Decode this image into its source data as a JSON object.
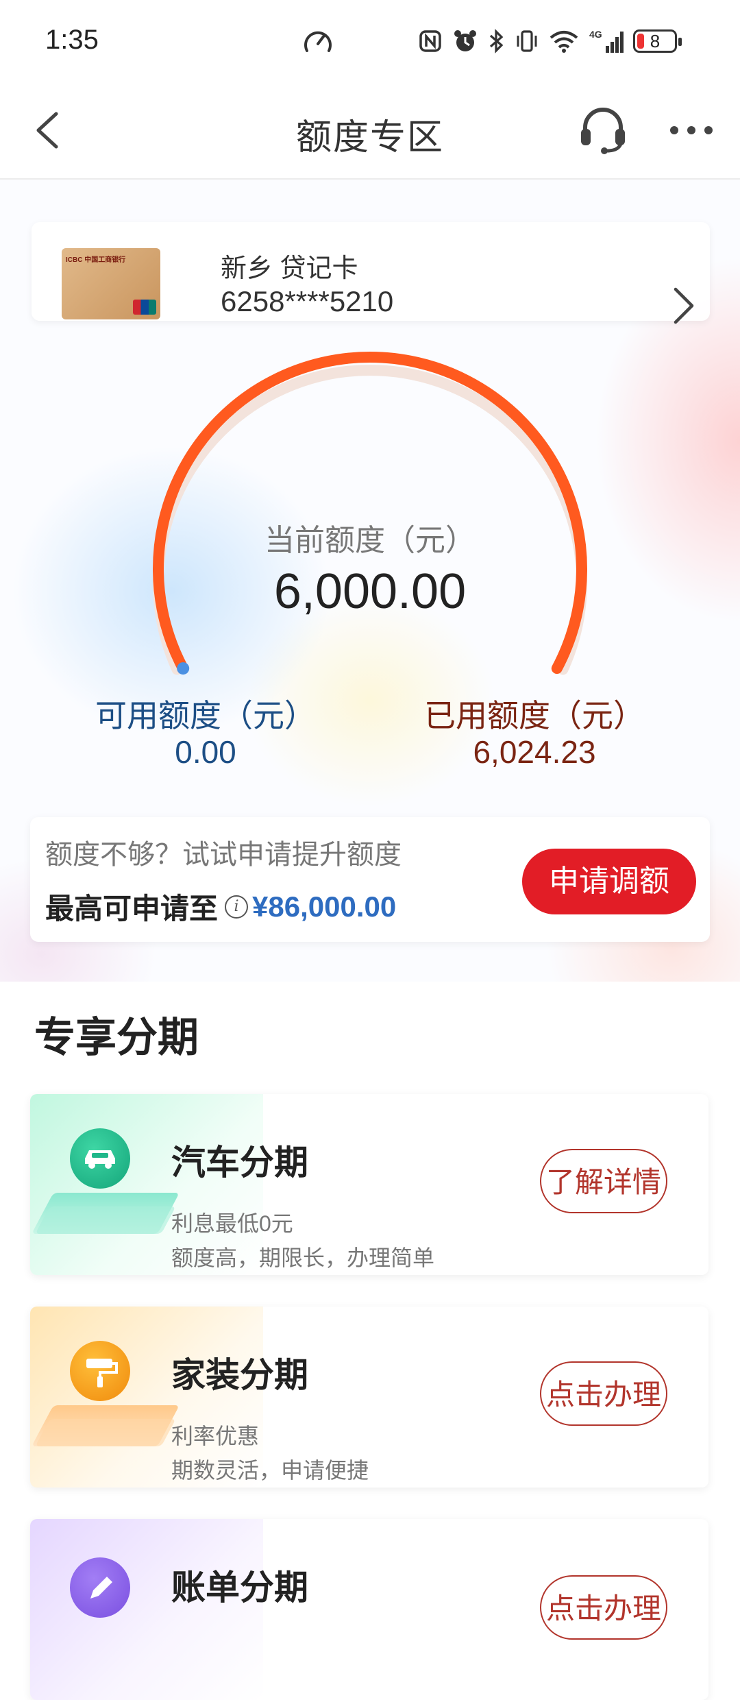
{
  "status_bar": {
    "time": "1:35",
    "battery": "8",
    "network": "4G"
  },
  "nav": {
    "title": "额度专区",
    "back_icon": "back-arrow-icon",
    "service_icon": "headset-icon",
    "more_icon": "more-icon"
  },
  "card": {
    "name": "新乡 贷记卡",
    "number": "6258****5210",
    "thumb_bank_text": "ICBC 中国工商银行"
  },
  "credit": {
    "current_label": "当前额度（元）",
    "current_value": "6,000.00",
    "available_label": "可用额度（元）",
    "available_value": "0.00",
    "used_label": "已用额度（元）",
    "used_value": "6,024.23",
    "gauge_used_fraction": 1.0
  },
  "promo": {
    "text": "额度不够？试试申请提升额度",
    "max_label": "最高可申请至",
    "max_amount": "¥86,000.00",
    "button": "申请调额"
  },
  "section": {
    "title": "专享分期"
  },
  "installments": [
    {
      "title": "汽车分期",
      "line1": "利息最低0元",
      "line2": "额度高，期限长，办理简单",
      "button": "了解详情",
      "icon": "car-icon",
      "color": "#1fb88a"
    },
    {
      "title": "家装分期",
      "line1": "利率优惠",
      "line2": "期数灵活，申请便捷",
      "button": "点击办理",
      "icon": "paint-roller-icon",
      "color": "#f6a21a"
    },
    {
      "title": "账单分期",
      "line1": "",
      "line2": "",
      "button": "点击办理",
      "icon": "pen-icon",
      "color": "#8b62e8"
    }
  ],
  "colors": {
    "accent_red": "#e21d26",
    "gauge_orange": "#ff5a1f",
    "available_blue": "#1c4e85",
    "used_brown": "#7a2412"
  }
}
